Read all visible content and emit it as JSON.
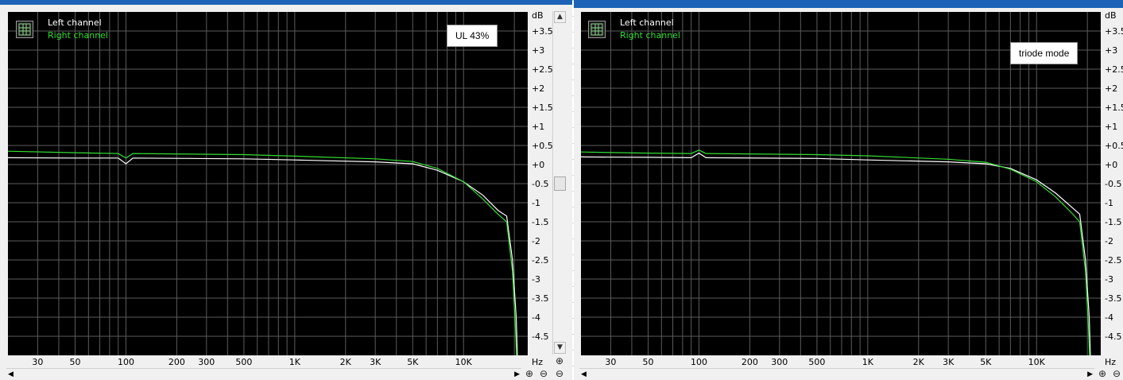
{
  "chart_data": [
    {
      "type": "line",
      "annotation": "UL 43%",
      "ylabel_unit": "dB",
      "xlabel_unit": "Hz",
      "x_scale": "log",
      "xlim": [
        20,
        24000
      ],
      "ylim": [
        -5,
        4
      ],
      "y_ticks": [
        "+3.5",
        "+3",
        "+2.5",
        "+2",
        "+1.5",
        "+1",
        "+0.5",
        "+0",
        "-0.5",
        "-1",
        "-1.5",
        "-2",
        "-2.5",
        "-3",
        "-3.5",
        "-4",
        "-4.5"
      ],
      "x_ticks": [
        {
          "label": "30",
          "value": 30
        },
        {
          "label": "50",
          "value": 50
        },
        {
          "label": "100",
          "value": 100
        },
        {
          "label": "200",
          "value": 200
        },
        {
          "label": "300",
          "value": 300
        },
        {
          "label": "500",
          "value": 500
        },
        {
          "label": "1K",
          "value": 1000
        },
        {
          "label": "2K",
          "value": 2000
        },
        {
          "label": "3K",
          "value": 3000
        },
        {
          "label": "5K",
          "value": 5000
        },
        {
          "label": "10K",
          "value": 10000
        }
      ],
      "grid": true,
      "legend_position": "top-left",
      "series": [
        {
          "name": "Left channel",
          "color": "#ffffff",
          "points": [
            [
              20,
              0.18
            ],
            [
              50,
              0.17
            ],
            [
              90,
              0.17
            ],
            [
              100,
              0.02
            ],
            [
              110,
              0.17
            ],
            [
              500,
              0.15
            ],
            [
              1000,
              0.12
            ],
            [
              3000,
              0.07
            ],
            [
              5000,
              0.02
            ],
            [
              7000,
              -0.15
            ],
            [
              10000,
              -0.45
            ],
            [
              13000,
              -0.8
            ],
            [
              16000,
              -1.2
            ],
            [
              18000,
              -1.35
            ],
            [
              19500,
              -2.5
            ],
            [
              20500,
              -4.0
            ],
            [
              21000,
              -5.5
            ]
          ]
        },
        {
          "name": "Right channel",
          "color": "#33dd33",
          "points": [
            [
              20,
              0.35
            ],
            [
              50,
              0.31
            ],
            [
              90,
              0.29
            ],
            [
              100,
              0.17
            ],
            [
              110,
              0.29
            ],
            [
              500,
              0.26
            ],
            [
              1000,
              0.22
            ],
            [
              3000,
              0.15
            ],
            [
              5000,
              0.08
            ],
            [
              7000,
              -0.1
            ],
            [
              10000,
              -0.45
            ],
            [
              13000,
              -0.9
            ],
            [
              16000,
              -1.3
            ],
            [
              18000,
              -1.5
            ],
            [
              19500,
              -2.8
            ],
            [
              20300,
              -4.3
            ],
            [
              20800,
              -5.5
            ]
          ]
        }
      ]
    },
    {
      "type": "line",
      "annotation": "triode mode",
      "ylabel_unit": "dB",
      "xlabel_unit": "Hz",
      "x_scale": "log",
      "xlim": [
        20,
        24000
      ],
      "ylim": [
        -5,
        4
      ],
      "y_ticks": [
        "+3.5",
        "+3",
        "+2.5",
        "+2",
        "+1.5",
        "+1",
        "+0.5",
        "+0",
        "-0.5",
        "-1",
        "-1.5",
        "-2",
        "-2.5",
        "-3",
        "-3.5",
        "-4",
        "-4.5"
      ],
      "x_ticks": [
        {
          "label": "30",
          "value": 30
        },
        {
          "label": "50",
          "value": 50
        },
        {
          "label": "100",
          "value": 100
        },
        {
          "label": "200",
          "value": 200
        },
        {
          "label": "300",
          "value": 300
        },
        {
          "label": "500",
          "value": 500
        },
        {
          "label": "1K",
          "value": 1000
        },
        {
          "label": "2K",
          "value": 2000
        },
        {
          "label": "3K",
          "value": 3000
        },
        {
          "label": "5K",
          "value": 5000
        },
        {
          "label": "10K",
          "value": 10000
        }
      ],
      "grid": true,
      "legend_position": "top-left",
      "series": [
        {
          "name": "Left channel",
          "color": "#ffffff",
          "points": [
            [
              20,
              0.2
            ],
            [
              50,
              0.19
            ],
            [
              90,
              0.18
            ],
            [
              100,
              0.3
            ],
            [
              110,
              0.18
            ],
            [
              500,
              0.16
            ],
            [
              1000,
              0.12
            ],
            [
              3000,
              0.07
            ],
            [
              5000,
              0.02
            ],
            [
              7000,
              -0.1
            ],
            [
              10000,
              -0.4
            ],
            [
              13000,
              -0.75
            ],
            [
              16000,
              -1.1
            ],
            [
              18000,
              -1.3
            ],
            [
              19500,
              -2.5
            ],
            [
              20500,
              -4.0
            ],
            [
              21000,
              -5.5
            ]
          ]
        },
        {
          "name": "Right channel",
          "color": "#33dd33",
          "points": [
            [
              20,
              0.33
            ],
            [
              50,
              0.3
            ],
            [
              90,
              0.29
            ],
            [
              100,
              0.38
            ],
            [
              110,
              0.29
            ],
            [
              500,
              0.26
            ],
            [
              1000,
              0.23
            ],
            [
              3000,
              0.14
            ],
            [
              5000,
              0.06
            ],
            [
              7000,
              -0.12
            ],
            [
              10000,
              -0.45
            ],
            [
              13000,
              -0.85
            ],
            [
              16000,
              -1.25
            ],
            [
              18000,
              -1.5
            ],
            [
              19500,
              -2.8
            ],
            [
              20300,
              -4.3
            ],
            [
              20800,
              -5.5
            ]
          ]
        }
      ]
    }
  ],
  "ui": {
    "zoom_in_icon": "magnifier-plus-icon",
    "zoom_out_icon": "magnifier-minus-icon",
    "scroll_up_glyph": "▲",
    "scroll_down_glyph": "▼",
    "scroll_left_glyph": "◀",
    "scroll_right_glyph": "▶"
  }
}
